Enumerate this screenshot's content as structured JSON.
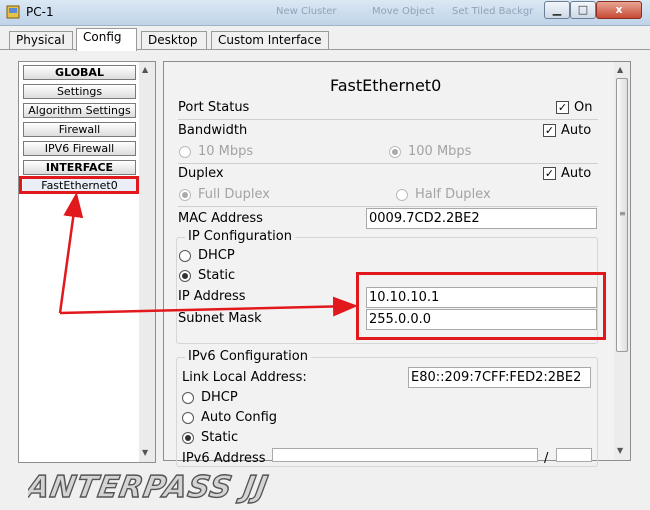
{
  "window": {
    "title": "PC-1",
    "ghost_titles": [
      "New Cluster",
      "Move Object",
      "Set Tiled Backgr"
    ],
    "minimize_glyph": "▁",
    "maximize_glyph": "□",
    "close_glyph": "x"
  },
  "tabs": [
    "Physical",
    "Config",
    "Desktop",
    "Custom Interface"
  ],
  "sidebar": {
    "items": [
      "GLOBAL",
      "Settings",
      "Algorithm Settings",
      "Firewall",
      "IPV6 Firewall",
      "INTERFACE",
      "FastEthernet0"
    ]
  },
  "panel": {
    "title": "FastEthernet0",
    "port_status": {
      "label": "Port Status",
      "check_label": "On",
      "checked": true
    },
    "bandwidth": {
      "label": "Bandwidth",
      "check_label": "Auto",
      "checked": true,
      "opt1": "10 Mbps",
      "opt2": "100 Mbps"
    },
    "duplex": {
      "label": "Duplex",
      "check_label": "Auto",
      "checked": true,
      "opt1": "Full Duplex",
      "opt2": "Half Duplex"
    },
    "mac": {
      "label": "MAC Address",
      "value": "0009.7CD2.2BE2"
    },
    "ipconfig": {
      "title": "IP Configuration",
      "dhcp": "DHCP",
      "static": "Static",
      "ip_label": "IP Address",
      "ip_value": "10.10.10.1",
      "mask_label": "Subnet Mask",
      "mask_value": "255.0.0.0"
    },
    "ipv6": {
      "title": "IPv6 Configuration",
      "link_local_label": "Link Local Address:",
      "link_local_value": "E80::209:7CFF:FED2:2BE2",
      "dhcp": "DHCP",
      "auto": "Auto Config",
      "static": "Static",
      "addr_label": "IPv6 Address",
      "addr_value": "",
      "slash": "/",
      "prefix_value": ""
    }
  },
  "watermark": {
    "text": "ANTERPASS JJ"
  },
  "colors": {
    "highlight": "#e1191c",
    "watermark": "#c8c8c8"
  }
}
